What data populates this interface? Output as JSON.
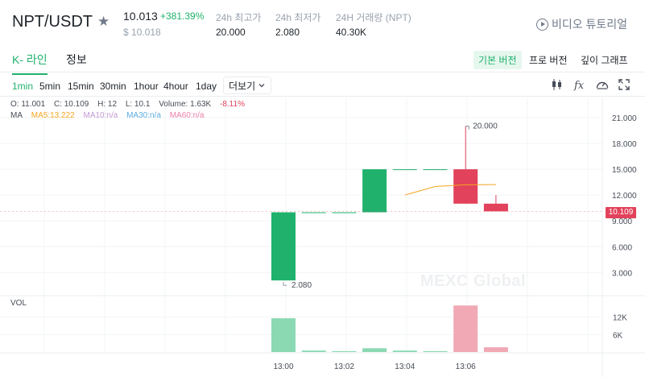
{
  "header": {
    "pair": "NPT/USDT",
    "price": "10.013",
    "change": "+381.39%",
    "price_usd": "$ 10.018",
    "stats": [
      {
        "label": "24h 최고가",
        "value": "20.000"
      },
      {
        "label": "24h 최저가",
        "value": "2.080"
      },
      {
        "label": "24H 거래량 (NPT)",
        "value": "40.30K"
      }
    ],
    "tutorial": "비디오 튜토리얼"
  },
  "tabs": {
    "kline": "K- 라인",
    "info": "정보",
    "views": [
      "기본 버전",
      "프로 버전",
      "깊이 그래프"
    ]
  },
  "toolbar": {
    "intervals": [
      "1min",
      "5min",
      "15min",
      "30min",
      "1hour",
      "4hour",
      "1day"
    ],
    "active_interval": "1min",
    "more": "더보기"
  },
  "legend": {
    "open": "O: 11.001",
    "close": "C: 10.109",
    "high": "H: 12",
    "low": "L: 10.1",
    "volume": "Volume: 1.63K",
    "change": "-8.11%",
    "ma_label": "MA",
    "ma5": "MA5:13.222",
    "ma10": "MA10:n/a",
    "ma30": "MA30:n/a",
    "ma60": "MA60:n/a",
    "vol_label": "VOL"
  },
  "watermark": "MEXC Global",
  "colors": {
    "up": "#20b26c",
    "down": "#e2425b",
    "ma5": "#f5a623",
    "ma10": "#c39bd3",
    "ma30": "#5dade2",
    "ma60": "#ec7fa9"
  },
  "chart_data": {
    "type": "candlestick",
    "x": [
      "13:00",
      "13:01",
      "13:02",
      "13:03",
      "13:04",
      "13:05",
      "13:06",
      "13:07"
    ],
    "x_tick_labels": [
      "13:00",
      "13:02",
      "13:04",
      "13:06"
    ],
    "open": [
      2.08,
      10.0,
      10.0,
      10.0,
      15.0,
      15.0,
      15.0,
      11.001
    ],
    "close": [
      10.0,
      10.0,
      10.0,
      15.0,
      15.0,
      15.0,
      11.0,
      10.109
    ],
    "high": [
      10.0,
      10.0,
      10.0,
      15.0,
      15.0,
      15.0,
      20.0,
      12.0
    ],
    "low": [
      2.08,
      10.0,
      10.0,
      10.0,
      15.0,
      15.0,
      11.0,
      10.1
    ],
    "volume": [
      11600,
      500,
      300,
      1300,
      500,
      300,
      16000,
      1630
    ],
    "ma5": [
      null,
      null,
      null,
      null,
      12.0,
      13.0,
      13.2,
      13.222
    ],
    "y_ticks": [
      "21.000",
      "18.000",
      "15.000",
      "12.000",
      "9.000",
      "6.000",
      "3.000"
    ],
    "ylim": [
      0.5,
      22.5
    ],
    "vol_ticks": [
      "12K",
      "6K"
    ],
    "vol_ylim": [
      0,
      18000
    ],
    "high_annotation": "20.000",
    "low_annotation": "2.080",
    "last_price": "10.109"
  }
}
